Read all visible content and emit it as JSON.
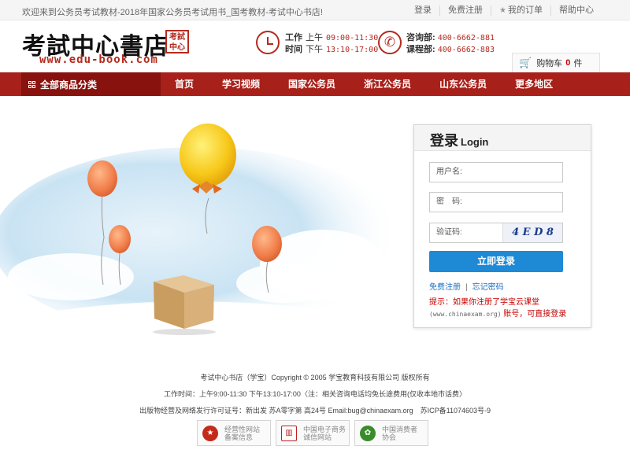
{
  "topbar": {
    "welcome": "欢迎来到公务员考试教材-2018年国家公务员考试用书_国考教材-考试中心书店!",
    "login": "登录",
    "register": "免费注册",
    "my_orders": "我的订单",
    "help": "帮助中心"
  },
  "header": {
    "logo_text": "考試中心書店",
    "logo_seal": "考試中心",
    "logo_url": "www.edu-book.com",
    "hours": {
      "label": "工作",
      "label2": "时间",
      "am_label": "上午",
      "am": "09:00-11:30",
      "pm_label": "下午",
      "pm": "13:10-17:00"
    },
    "contact": {
      "consult_label": "咨询部:",
      "consult": "400-6662-881",
      "course_label": "课程部:",
      "course": "400-6662-883"
    },
    "cart": {
      "label": "购物车",
      "count": "0",
      "unit": "件"
    }
  },
  "nav": {
    "all_categories": "全部商品分类",
    "items": [
      "首页",
      "学习视频",
      "国家公务员",
      "浙江公务员",
      "山东公务员",
      "更多地区"
    ]
  },
  "login": {
    "title": "登录",
    "title_en": "Login",
    "username_placeholder": "用户名:",
    "password_placeholder": "密　码:",
    "captcha_placeholder": "验证码:",
    "captcha_text": "4 E D 8",
    "submit": "立即登录",
    "register_link": "免费注册",
    "forgot_link": "忘记密码",
    "tip_line1": "提示：如果你注册了学宝云课堂",
    "tip_url": "(www.chinaexam.org)",
    "tip_line2": "账号，可直接登录"
  },
  "footer": {
    "copyright": "考试中心书店（学宝）Copyright © 2005 学宝教育科技有限公司 版权所有",
    "hours": "工作时间：上午9:00-11:30 下午13:10-17:00〈注：相关咨询电话均免长途费用(仅收本地市话费〉",
    "license": "出版物经营及网络发行许可证号：新出发 苏A零字第 高24号 Email:bug@chinaexam.org　苏ICP备11074603号-9",
    "badges": [
      {
        "line1": "经营性网站",
        "line2": "备案信息"
      },
      {
        "line1": "中国电子商务",
        "line2": "诚信网站"
      },
      {
        "line1": "中国消费者",
        "line2": "协会"
      }
    ]
  },
  "colors": {
    "brand_red": "#a8201a",
    "nav_dark": "#87120e",
    "login_blue": "#1e8ad6"
  }
}
